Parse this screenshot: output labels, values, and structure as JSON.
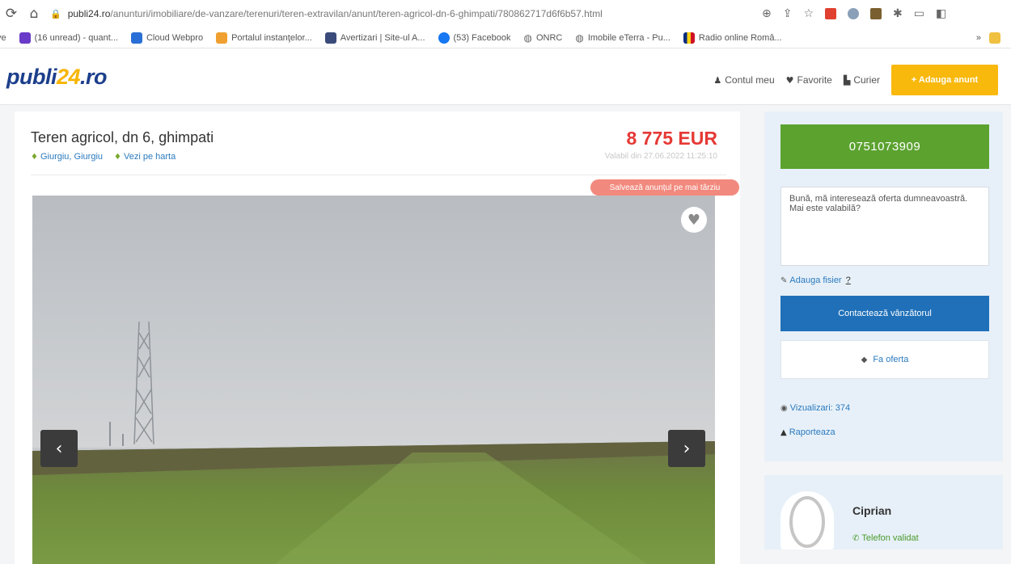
{
  "browser": {
    "url_host": "publi24.ro",
    "url_path": "/anunturi/imobiliare/de-vanzare/terenuri/teren-extravilan/anunt/teren-agricol-dn-6-ghimpati/780862717d6f6b57.html",
    "bookmarks": [
      {
        "label": "(16 unread) - quant...",
        "color": "#6a3bc8"
      },
      {
        "label": "Cloud Webpro",
        "color": "#2a6fd6"
      },
      {
        "label": "Portalul instanţelor...",
        "color": "#f0a030"
      },
      {
        "label": "Avertizari | Site-ul A...",
        "color": "#3a4a7a"
      },
      {
        "label": "(53) Facebook",
        "color": "#1877f2"
      },
      {
        "label": "ONRC",
        "color": ""
      },
      {
        "label": "Imobile eTerra - Pu...",
        "color": ""
      },
      {
        "label": "Radio online Româ...",
        "color": "#cc2020"
      }
    ],
    "bm_overflow": "»"
  },
  "header": {
    "logo_main": "publi",
    "logo_accent": "24",
    "logo_tail": ".ro",
    "nav": {
      "account": "Contul meu",
      "favorites": "Favorite",
      "courier": "Curier",
      "add_ad": "+ Adauga anunt"
    }
  },
  "ad": {
    "title": "Teren agricol, dn 6, ghimpati",
    "location": "Giurgiu, Giurgiu",
    "map_link": "Vezi pe harta",
    "price": "8 775 EUR",
    "valid_until": "Valabil din 27.06.2022 11:25:10",
    "save_later": "Salvează anunțul pe mai târziu"
  },
  "sidebar": {
    "phone": "0751073909",
    "message": "Bună, mă interesează oferta dumneavoastră. Mai este valabilă?",
    "attach_label": "Adauga fisier",
    "attach_help": "?",
    "contact_button": "Contactează vânzătorul",
    "offer_button": "Fa oferta",
    "views_label": "Vizualizari: 374",
    "report_label": "Raporteaza"
  },
  "seller": {
    "name": "Ciprian",
    "phone_status": "Telefon validat"
  },
  "colors": {
    "brand_blue": "#1c3f8c",
    "brand_yellow": "#f7b500",
    "price_red": "#e53935",
    "phone_green": "#5ba22f",
    "contact_blue": "#1f70b8"
  }
}
